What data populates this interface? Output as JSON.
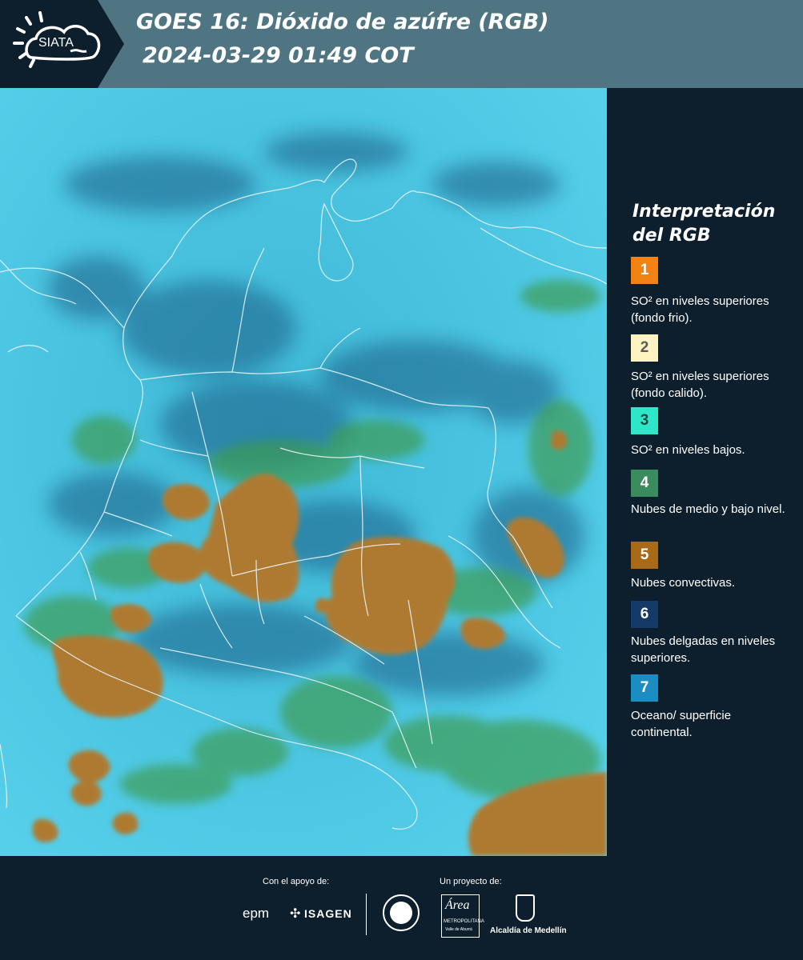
{
  "header": {
    "logo_text": "SIATA",
    "title_line1": "GOES 16: Dióxido de azúfre (RGB)",
    "title_line2": "2024-03-29 01:49 COT"
  },
  "legend": {
    "title_line1": "Interpretación",
    "title_line2": "del RGB",
    "items": [
      {
        "number": "1",
        "color": "#f28214",
        "number_color": "#ffffff",
        "text": "SO² en niveles superiores (fondo frio)."
      },
      {
        "number": "2",
        "color": "#fdf3c1",
        "number_color": "#5a5a5a",
        "text": "SO² en niveles superiores (fondo calido)."
      },
      {
        "number": "3",
        "color": "#2ee6c8",
        "number_color": "#1a4a45",
        "text": "SO² en niveles bajos."
      },
      {
        "number": "4",
        "color": "#3a8c5e",
        "number_color": "#ffffff",
        "text": "Nubes de medio y bajo nivel."
      },
      {
        "number": "5",
        "color": "#a86a16",
        "number_color": "#ffffff",
        "text": "Nubes convectivas."
      },
      {
        "number": "6",
        "color": "#143a68",
        "number_color": "#ffffff",
        "text": "Nubes delgadas en niveles superiores."
      },
      {
        "number": "7",
        "color": "#1a8ec2",
        "number_color": "#ffffff",
        "text": "Oceano/ superficie continental."
      }
    ]
  },
  "footer": {
    "support_label": "Con el apoyo de:",
    "support_logo1": "epm",
    "support_logo2": "ISAGEN",
    "project_label": "Un proyecto de:",
    "project_logo1": "Área",
    "project_logo1_sub": "METROPOLITANA",
    "project_logo1_sub2": "Valle de Aburrá",
    "project_logo2": "Alcaldía de Medellín"
  }
}
